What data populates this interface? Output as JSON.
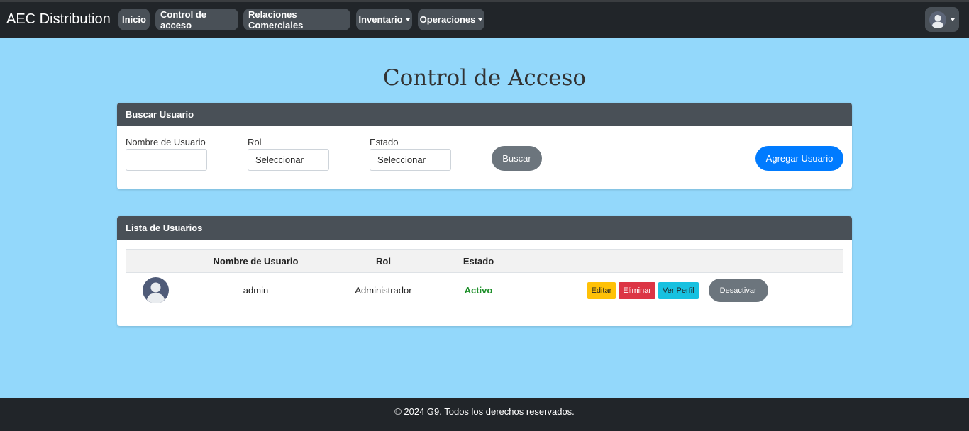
{
  "navbar": {
    "brand": "AEC Distribution",
    "items": [
      {
        "label": "Inicio",
        "dropdown": false
      },
      {
        "label": "Control de acceso",
        "dropdown": false
      },
      {
        "label": "Relaciones Comerciales",
        "dropdown": false
      },
      {
        "label": "Inventario",
        "dropdown": true
      },
      {
        "label": "Operaciones",
        "dropdown": true
      }
    ],
    "user_icon": "user-avatar-icon"
  },
  "page": {
    "title": "Control de Acceso"
  },
  "search_card": {
    "header": "Buscar Usuario",
    "username_label": "Nombre de Usuario",
    "username_value": "",
    "role_label": "Rol",
    "role_value": "Seleccionar",
    "status_label": "Estado",
    "status_value": "Seleccionar",
    "search_button": "Buscar",
    "add_button": "Agregar Usuario"
  },
  "list_card": {
    "header": "Lista de Usuarios",
    "columns": [
      "",
      "Nombre de Usuario",
      "Rol",
      "Estado",
      ""
    ],
    "rows": [
      {
        "username": "admin",
        "role": "Administrador",
        "status": "Activo",
        "actions": {
          "edit": "Editar",
          "delete": "Eliminar",
          "profile": "Ver Perfil",
          "deactivate": "Desactivar"
        }
      }
    ]
  },
  "footer": {
    "text": "© 2024 G9. Todos los derechos reservados."
  },
  "colors": {
    "page_bg": "#93d8fb",
    "navbar_bg": "#212529",
    "pill_bg": "#495057",
    "primary": "#007bff",
    "secondary": "#6c757d",
    "warning": "#ffc107",
    "danger": "#dc3545",
    "info": "#17c1e0",
    "success_text": "#1e8f2a"
  }
}
